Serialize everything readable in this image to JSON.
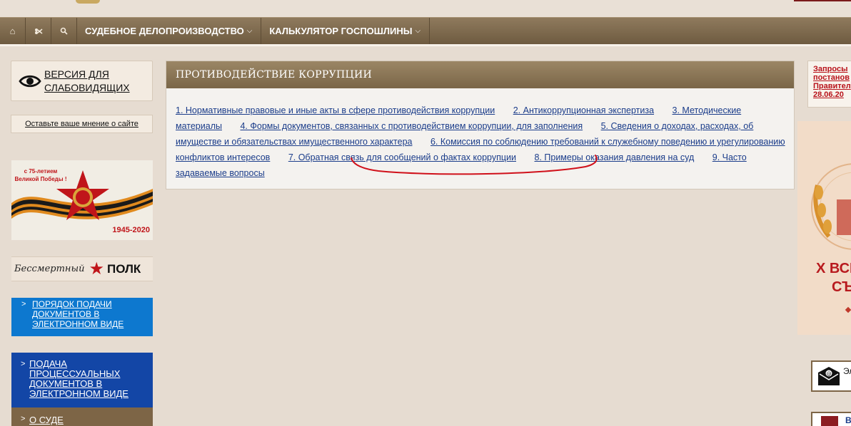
{
  "nav": {
    "icons": [
      "home-icon",
      "sitemap-icon",
      "search-icon"
    ],
    "items": [
      {
        "label": "СУДЕБНОЕ ДЕЛОПРОИЗВОДСТВО"
      },
      {
        "label": "КАЛЬКУЛЯТОР ГОСПОШЛИНЫ"
      }
    ]
  },
  "sidebar": {
    "vision_label": "ВЕРСИЯ ДЛЯ СЛАБОВИДЯЩИХ",
    "opinion_label": "Оставьте ваше мнение о сайте",
    "victory_banner": {
      "top_text": "с 75-летием Великой Победы !",
      "years": "1945-2020"
    },
    "polk_banner": {
      "script_text": "Бессмертный",
      "main_text": "ПОЛК"
    },
    "edoc_label": "ПОРЯДОК ПОДАЧИ ДОКУМЕНТОВ В ЭЛЕКТРОННОМ ВИДЕ",
    "proc_label": "ПОДАЧА ПРОЦЕССУАЛЬНЫХ ДОКУМЕНТОВ В ЭЛЕКТРОННОМ ВИДЕ",
    "court_label": "О СУДЕ",
    "arrow": ">"
  },
  "panel": {
    "title": "ПРОТИВОДЕЙСТВИЕ КОРРУПЦИИ",
    "links": [
      "1. Нормативные правовые и иные акты в сфере противодействия коррупции",
      "2. Антикоррупционная экспертиза",
      "3. Методические материалы",
      "4. Формы документов, связанных с противодействием коррупции, для заполнения",
      "5. Сведения о доходах, расходах, об имуществе и обязательствах имущественного характера",
      "6. Комиссия по соблюдению требований к служебному поведению и урегулированию конфликтов интересов",
      "7. Обратная связь для сообщений о фактах коррупции",
      "8. Примеры оказания давления на суд",
      "9. Часто задаваемые вопросы"
    ],
    "highlight_color": "#d0101a"
  },
  "right": {
    "notice_lines": [
      "Запросы",
      "постанов",
      "Правител",
      "28.06.20"
    ],
    "congress_line1": "Х ВСЕ",
    "congress_line2": "СЪ",
    "mail_label": "Эл",
    "emblem_label": "В"
  },
  "colors": {
    "nav_bg": "#7d6849",
    "link": "#1a3c8a",
    "accent_red": "#b8121a",
    "blue_banner": "#0d78cf",
    "dark_blue_banner": "#1346a6"
  }
}
